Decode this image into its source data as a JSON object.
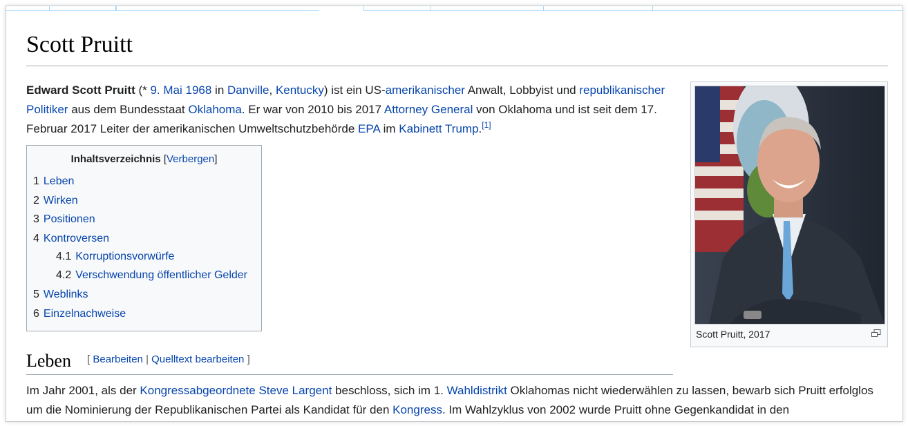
{
  "page": {
    "title": "Scott Pruitt"
  },
  "intro": {
    "name_bold": "Edward Scott Pruitt",
    "open": " (* ",
    "birth_date": "9. Mai 1968",
    "in_word": " in ",
    "birth_city": "Danville",
    "comma": ", ",
    "birth_state": "Kentucky",
    "close_rest1": ") ist ein US-",
    "link_amerikanischer": "amerikanischer",
    "t_anwalt": " Anwalt, Lobbyist und ",
    "link_politiker": "republikanischer Politiker",
    "t_bundesstaat": " aus dem Bundesstaat ",
    "link_oklahoma": "Oklahoma",
    "t_war": ". Er war von 2010 bis 2017 ",
    "link_ag": "Attorney General",
    "t_von": " von Oklahoma und ist seit dem 17. Februar 2017 Leiter der amerikanischen Umweltschutzbehörde ",
    "link_epa": "EPA",
    "t_im": " im ",
    "link_kabinett": "Kabinett Trump",
    "t_dot": ".",
    "ref": "[1]"
  },
  "toc": {
    "heading": "Inhaltsverzeichnis",
    "toggle_open": " [",
    "toggle_label": "Verbergen",
    "toggle_close": "]",
    "items": [
      {
        "num": "1",
        "label": "Leben"
      },
      {
        "num": "2",
        "label": "Wirken"
      },
      {
        "num": "3",
        "label": "Positionen"
      },
      {
        "num": "4",
        "label": "Kontroversen"
      },
      {
        "num": "4.1",
        "label": "Korruptionsvorwürfe"
      },
      {
        "num": "4.2",
        "label": "Verschwendung öffentlicher Gelder"
      },
      {
        "num": "5",
        "label": "Weblinks"
      },
      {
        "num": "6",
        "label": "Einzelnachweise"
      }
    ]
  },
  "infobox": {
    "caption": "Scott Pruitt, 2017",
    "magnify_icon": "magnify-icon"
  },
  "section_leben": {
    "heading": "Leben",
    "edit_open": "[ ",
    "edit_label": "Bearbeiten",
    "edit_sep": " | ",
    "source_label": "Quelltext bearbeiten",
    "edit_close": " ]"
  },
  "body": {
    "t1": "Im Jahr 2001, als der ",
    "link_kongressabg": "Kongressabgeordnete",
    "sp1": " ",
    "link_largent": "Steve Largent",
    "t2": " beschloss, sich im 1. ",
    "link_wahldistrikt": "Wahldistrikt",
    "t3": " Oklahomas nicht wiederwählen zu lassen, bewarb sich Pruitt erfolglos um die Nominierung der Republikanischen Partei als Kandidat für den ",
    "link_kongress": "Kongress",
    "t4": ". Im Wahlzyklus von 2002 wurde Pruitt ohne Gegenkandidat in den"
  }
}
